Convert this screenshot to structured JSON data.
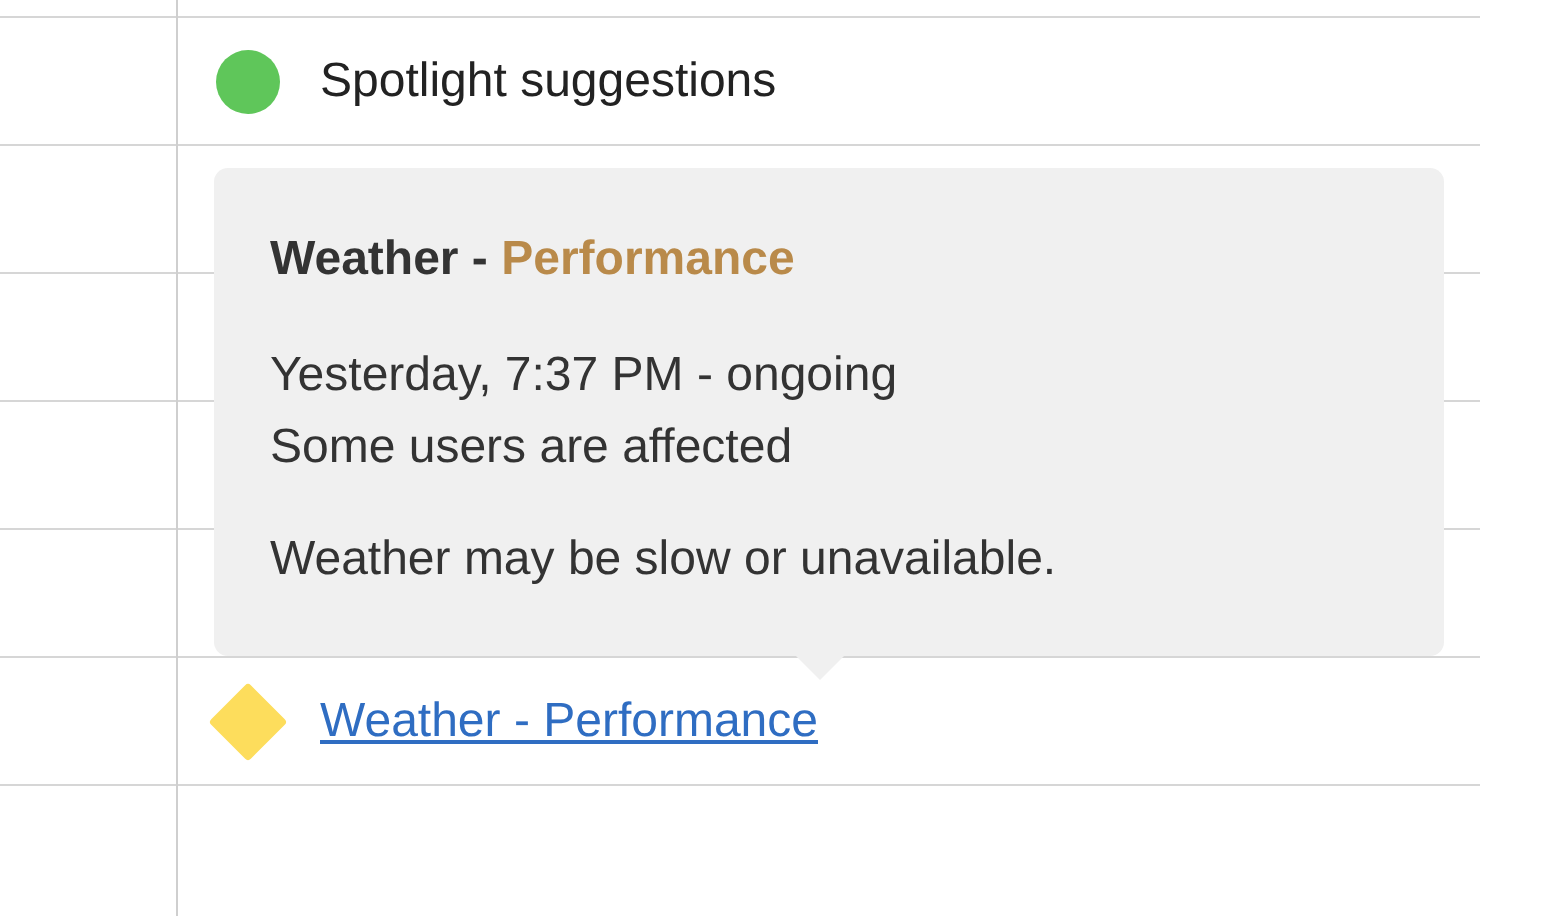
{
  "rows": [
    {
      "kind": "dot",
      "label": "Spotlight suggestions",
      "color": "#5fc65a",
      "link": false
    },
    {
      "kind": "empty"
    },
    {
      "kind": "empty"
    },
    {
      "kind": "empty"
    },
    {
      "kind": "empty"
    },
    {
      "kind": "diamond",
      "label": "Weather - Performance",
      "color": "#fddd5c",
      "link": true
    },
    {
      "kind": "empty"
    }
  ],
  "tooltip": {
    "title": "Weather - ",
    "category": "Performance",
    "time": "Yesterday, 7:37 PM - ongoing",
    "scope": "Some users are affected",
    "message": "Weather may be slow or unavailable."
  }
}
